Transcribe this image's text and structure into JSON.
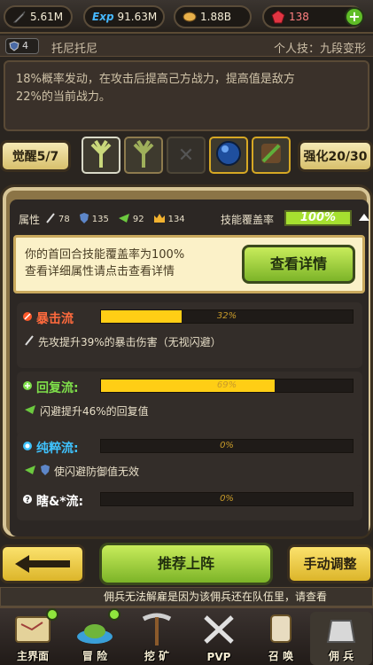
{
  "resources": {
    "gold": "5.61M",
    "exp_label": "Exp",
    "exp": "91.63M",
    "food": "1.88B",
    "gems": "138"
  },
  "hero": {
    "level": "4",
    "name": "托尼托尼",
    "personal_skill": "个人技：九段变形",
    "description_line1": "18%概率发动，在攻击后提高己方战力，提高值是敌方",
    "description_line2": "22%的当前战力。"
  },
  "skills": {
    "awaken_label": "觉醒5/7",
    "enhance_label": "强化20/30"
  },
  "attributes": {
    "label": "属性",
    "attack": "78",
    "defense": "135",
    "dodge": "92",
    "crown": "134",
    "coverage_label": "技能覆盖率",
    "coverage_value": "100%"
  },
  "info": {
    "line1": "你的首回合技能覆盖率为100%",
    "line2": "查看详细属性请点击查看详情",
    "detail_button": "查看详情"
  },
  "flows": [
    {
      "title": "暴击流",
      "percent": 32,
      "percent_label": "32%",
      "desc": "先攻提升39%的暴击伤害（无视闪避）",
      "color": "#ff6a3d"
    },
    {
      "title": "回复流:",
      "percent": 69,
      "percent_label": "69%",
      "desc": "闪避提升46%的回复值",
      "color": "#7fe04a"
    },
    {
      "title": "纯粹流:",
      "percent": 0,
      "percent_label": "0%",
      "desc": "使闪避防御值无效",
      "color": "#3fc3ff"
    },
    {
      "title": "瞎&*流:",
      "percent": 0,
      "percent_label": "0%",
      "desc": "",
      "color": "#ffffff"
    }
  ],
  "actions": {
    "recommend": "推荐上阵",
    "manual": "手动调整"
  },
  "notice": "佣兵无法解雇是因为该佣兵还在队伍里，请查看",
  "nav": [
    {
      "label": "主界面"
    },
    {
      "label": "冒 险"
    },
    {
      "label": "挖 矿"
    },
    {
      "label": "PVP"
    },
    {
      "label": "召 唤"
    },
    {
      "label": "佣 兵"
    }
  ]
}
